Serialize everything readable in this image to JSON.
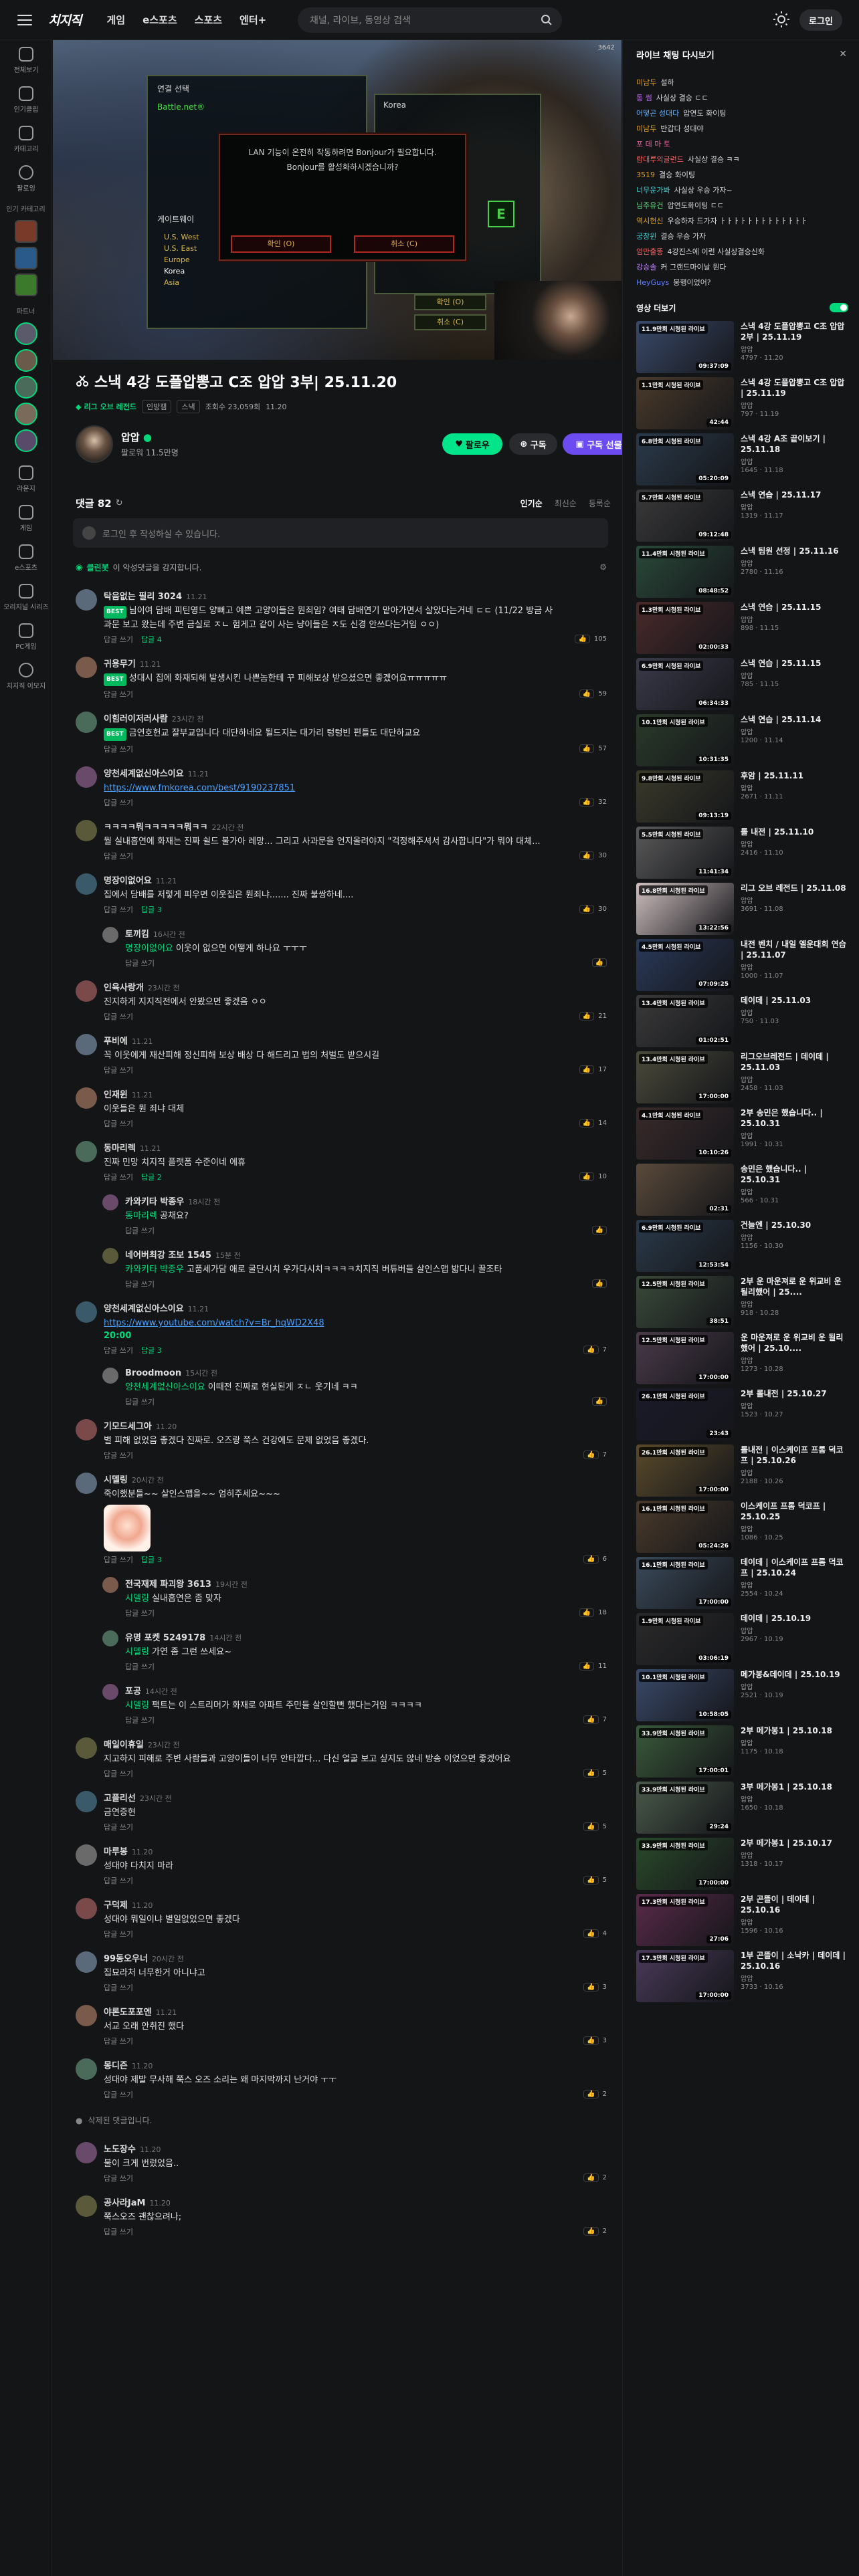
{
  "header": {
    "logo": "치지직",
    "nav": [
      "게임",
      "e스포츠",
      "스포츠",
      "엔터+"
    ],
    "search_placeholder": "채널, 라이브, 동영상 검색",
    "login": "로그인"
  },
  "sidebar": {
    "items": [
      "전체보기",
      "인기클립",
      "카테고리",
      "팔로잉"
    ],
    "section_recommend": "인기 카테고리",
    "section_partner": "파트너",
    "items2": [
      "라운지",
      "게임",
      "e스포츠",
      "오리지널 시리즈",
      "PC게임",
      "치지직 이모지"
    ]
  },
  "player": {
    "panel_title": "연결 선택",
    "panel_mode": "Battle.net®",
    "panel_region": "게이트웨이",
    "regions": [
      "U.S. West",
      "U.S. East",
      "Europe",
      "Korea",
      "Asia"
    ],
    "right_title": "Korea",
    "dialog_text_1": "LAN 기능이 온전히 작동하려면 Bonjour가 필요합니다.",
    "dialog_text_2": "Bonjour를 활성화하시겠습니까?",
    "dialog_ok": "확인 (O)",
    "dialog_cancel": "취소 (C)",
    "btn_ok": "확인 (O)",
    "btn_cancel": "취소 (C)",
    "e_key": "E",
    "fps": "3642"
  },
  "video": {
    "title": "스낵 4강 도플압뽕고 C조 압압 3부|  25.11.20",
    "category": "리그 오브 레전드",
    "tags": [
      "인방잼",
      "스낵"
    ],
    "views": "조회수 23,059회",
    "date": "11.20"
  },
  "channel": {
    "name": "압압",
    "followers": "팔로워 11.5만명",
    "follow": "팔로우",
    "subscribe": "구독",
    "gift": "구독 선물"
  },
  "comments": {
    "count": "댓글 82",
    "sort": [
      "인기순",
      "최신순",
      "등록순"
    ],
    "input_placeholder": "로그인 후 작성하실 수 있습니다.",
    "clean_label": "클린봇",
    "clean_text": "이 악성댓글을 감지합니다.",
    "reply_label": "답글 쓰기",
    "list": [
      {
        "name": "탁음없는 필리 3024",
        "time": "11.21",
        "best": true,
        "text": "님이여 담배 피틴영드 양뻐고 예쁜 고양이들은 뭔죄임? 여태 담배연기 맡아가면서 살았다는거네 ㄷㄷ (11/22 방금 사과문 보고 왔는데 주변 금실로 ㅈㄴ 험게고 같이 사는 냥이들은 ㅈ도 신경 안쓰다는거임 ㅇㅇ)",
        "replies": "답글 4",
        "likes": "105",
        "reply": false
      },
      {
        "name": "귀용무기",
        "time": "11.21",
        "best": true,
        "text": "성대시 집에 화재되해 발생시킨 나쁜놈한테 꾸 피해보상 받으셨으면 좋겠어요ㅠㅠㅠㅠㅠ",
        "replies": "",
        "likes": "59",
        "reply": false
      },
      {
        "name": "이힘러이저러사람",
        "time": "23시간 전",
        "best": true,
        "text": "금연호헌교 잘부교입니다 대단하네요 될드지는 대가리 텅텅빈 편들도 대단하교요",
        "replies": "",
        "likes": "57",
        "reply": false
      },
      {
        "name": "양천세계없신아스이요",
        "time": "11.21",
        "best": false,
        "link": "https://www.fmkorea.com/best/9190237851",
        "text": "",
        "replies": "",
        "likes": "32",
        "reply": false
      },
      {
        "name": "ㅋㅋㅋㅋ뭐ㅋㅋㅋㅋㅋ뭐ㅋㅋ",
        "time": "22시간 전",
        "best": false,
        "text": "뭘 실내흡연에 화재는 진짜 쉴드 불가아 레망... 그리고 사과문을 언지올려야지 \"걱정해주셔서 감사합니다\"가 뭐야 대체...",
        "replies": "",
        "likes": "30",
        "reply": false
      },
      {
        "name": "명장이없어요",
        "time": "11.21",
        "best": false,
        "text": "집에서 담배를 저렇게 피우면 이웃집은 뭔죄냐....... 진짜 불쌍하네....",
        "replies": "답글 3",
        "likes": "30",
        "reply": false
      },
      {
        "name": "토끼킴",
        "time": "16시간 전",
        "best": false,
        "mention": "명장이없어요",
        "text": "이웃이 없으면 어떻게 하나요 ㅜㅜㅜ",
        "replies": "",
        "likes": "",
        "reply": true
      },
      {
        "name": "인육사랑개",
        "time": "23시간 전",
        "best": false,
        "text": "진지하게 지지직전에서 안봤으면 좋겠음 ㅇㅇ",
        "replies": "",
        "likes": "21",
        "reply": false
      },
      {
        "name": "푸비에",
        "time": "11.21",
        "best": false,
        "text": "꼭 이웃에게 재산피해 정신피해 보상 배상 다 해드리고 법의 처벌도 받으시길",
        "replies": "",
        "likes": "17",
        "reply": false
      },
      {
        "name": "인재윈",
        "time": "11.21",
        "best": false,
        "text": "이웃들은 뭔 죄냐 대체",
        "replies": "",
        "likes": "14",
        "reply": false
      },
      {
        "name": "동마리렉",
        "time": "11.21",
        "best": false,
        "text": "진짜 민망 치지직 플랫폼 수준이네 에휴",
        "replies": "답글 2",
        "likes": "10",
        "reply": false
      },
      {
        "name": "카와키타 박종우",
        "time": "18시간 전",
        "best": false,
        "mention": "동마리렉",
        "text": "공채요?",
        "replies": "",
        "likes": "",
        "reply": true
      },
      {
        "name": "네어버최강 조보 1545",
        "time": "15분 전",
        "best": false,
        "mention": "카와키타 박종우",
        "text": "고품세가담 애로 굴단시치 우가다시치ㅋㅋㅋㅋ치지직 버튜버들 살인스맵 밟다니 꿀조타",
        "replies": "",
        "likes": "",
        "reply": true
      },
      {
        "name": "양천세계없신아스이요",
        "time": "11.21",
        "best": false,
        "link": "https://www.youtube.com/watch?v=Br_hqWD2X48",
        "timestamp": "20:00",
        "text": "",
        "replies": "답글 3",
        "likes": "7",
        "reply": false
      },
      {
        "name": "Broodmoon",
        "time": "15시간 전",
        "best": false,
        "mention": "양천세계없신아스이요",
        "text": "이때전 진짜로 현실된게 ㅈㄴ 웃기네 ㅋㅋ",
        "replies": "",
        "likes": "",
        "reply": true
      },
      {
        "name": "기모드세그아",
        "time": "11.20",
        "best": false,
        "text": "별 피해 없었음 좋겠다 진짜로. 오즈랑 쭉스 건강에도 문제 없었음 좋겠다.",
        "replies": "",
        "likes": "7",
        "reply": false
      },
      {
        "name": "시델링",
        "time": "20시간 전",
        "best": false,
        "text": "죽이했분들~~ 살인스맵을~~ 엄히주세요~~~",
        "emoji": true,
        "replies": "답글 3",
        "likes": "6",
        "reply": false
      },
      {
        "name": "전국재제 파괴왕 3613",
        "time": "19시간 전",
        "best": false,
        "mention": "시델링",
        "text": "실내흡연은 좀 맞자",
        "replies": "",
        "likes": "18",
        "reply": true
      },
      {
        "name": "유명 포켓 5249178",
        "time": "14시간 전",
        "best": false,
        "mention": "시델링",
        "text": "가연 좀 그런 쓰세요~",
        "replies": "",
        "likes": "11",
        "reply": true
      },
      {
        "name": "포공",
        "time": "14시간 전",
        "best": false,
        "mention": "시델링",
        "text": "팩트는 이 스트리머가 화재로 아파트 주민들 살인할뻔 했다는거임 ㅋㅋㅋㅋ",
        "replies": "",
        "likes": "7",
        "reply": true
      },
      {
        "name": "매일이휴일",
        "time": "23시간 전",
        "best": false,
        "text": "지고하지 피해로 주변 사람들과 고양이들이 너무 안타깝다... 다신 얼굴 보고 싶지도 않네 방송 이었으면 좋겠어요",
        "replies": "",
        "likes": "5",
        "reply": false
      },
      {
        "name": "고플리선",
        "time": "23시간 전",
        "best": false,
        "text": "금연증현",
        "replies": "",
        "likes": "5",
        "reply": false
      },
      {
        "name": "마루봉",
        "time": "11.20",
        "best": false,
        "text": "성대야 다치지 마라",
        "replies": "",
        "likes": "5",
        "reply": false
      },
      {
        "name": "구덕제",
        "time": "11.20",
        "best": false,
        "text": "성대야 뭐일이냐 별일없었으면 좋겠다",
        "replies": "",
        "likes": "4",
        "reply": false
      },
      {
        "name": "99동오우너",
        "time": "20시간 전",
        "best": false,
        "text": "집묘라처 너무한거 아니냐고",
        "replies": "",
        "likes": "3",
        "reply": false
      },
      {
        "name": "야론도포포엔",
        "time": "11.21",
        "best": false,
        "text": "서교 오래 안취진 했다",
        "replies": "",
        "likes": "3",
        "reply": false
      },
      {
        "name": "몽디즌",
        "time": "11.20",
        "best": false,
        "text": "성대야 제발 무사해 쭉스 오즈 소리는 왜 마지막까지 난거야 ㅜㅜ",
        "replies": "",
        "likes": "2",
        "reply": false
      }
    ],
    "deleted": "삭제된 댓글입니다.",
    "list_b": [
      {
        "name": "노도장수",
        "time": "11.20",
        "text": "불이 크게 번렀었음..",
        "likes": "2"
      },
      {
        "name": "공사라JaM",
        "time": "11.20",
        "text": "쭉스오즈 괜찮으려나;",
        "likes": "2"
      }
    ]
  },
  "chat": {
    "title": "라이브 채팅 다시보기",
    "messages": [
      {
        "n": "미남두",
        "m": "설하",
        "c": "#e0a020"
      },
      {
        "n": "통 썸",
        "m": "사실상 결승 ㄷㄷ",
        "c": "#c060f0"
      },
      {
        "n": "어떻곤 성대다",
        "m": "압연도 화이팅",
        "c": "#60b0ff"
      },
      {
        "n": "미남두",
        "m": "반갑다 성대야",
        "c": "#e0a020"
      },
      {
        "n": "포 데 마 토",
        "m": "",
        "c": "#f060a0"
      },
      {
        "n": "람대루의글런드",
        "m": "사실상 결승 ㅋㅋ",
        "c": "#ff6060"
      },
      {
        "n": "3519",
        "m": "결승 화이팅",
        "c": "#e0a020"
      },
      {
        "n": "너무운가봐",
        "m": "사실상 우승 가자~",
        "c": "#40d0d0"
      },
      {
        "n": "님주유건",
        "m": "압연도화이팅 ㄷㄷ",
        "c": "#60e080"
      },
      {
        "n": "역시헌신",
        "m": "우승하자 드가자 ㅏㅏㅏㅏㅏㅏㅏㅏㅏㅏㅏㅏㅏ",
        "c": "#e0a020"
      },
      {
        "n": "궁창윈",
        "m": "결승 우승 가자",
        "c": "#40d0d0"
      },
      {
        "n": "엄만출똥",
        "m": "4강진스에 이런 사실상결승신화",
        "c": "#f06060"
      },
      {
        "n": "강승솔",
        "m": "커 그랜드마이날 뭔다",
        "c": "#c080ff"
      },
      {
        "n": "HeyGuys",
        "m": "뭉행이었어?",
        "c": "#6080ff"
      }
    ],
    "video_list_title": "영상 더보기"
  },
  "videos": [
    {
      "badge": "11.9만회 시청된 라이브",
      "dur": "09:37:09",
      "title": "스낵 4강 도플압뽕고 C조 압압 2부 | 25.11.19",
      "ch": "압압",
      "stat": "4797 · 11.20",
      "c": "#3a4a6a"
    },
    {
      "badge": "1.1만회 시청된 라이브",
      "dur": "42:44",
      "title": "스낵 4강 도플압뽕고 C조 압압 | 25.11.19",
      "ch": "압압",
      "stat": "797 · 11.19",
      "c": "#4a3a2a"
    },
    {
      "badge": "6.8만회 시청된 라이브",
      "dur": "05:20:09",
      "title": "스낵 4강 A조 끝이보기 | 25.11.18",
      "ch": "압압",
      "stat": "1645 · 11.18",
      "c": "#2a3a4a"
    },
    {
      "badge": "5.7만회 시청된 라이브",
      "dur": "09:12:48",
      "title": "스낵 연습 | 25.11.17",
      "ch": "압압",
      "stat": "1319 · 11.17",
      "c": "#3a3a3a"
    },
    {
      "badge": "11.4만회 시청된 라이브",
      "dur": "08:48:52",
      "title": "스낵 팀원 선정 | 25.11.16",
      "ch": "압압",
      "stat": "2780 · 11.16",
      "c": "#2a4a3a"
    },
    {
      "badge": "1.3만회 시청된 라이브",
      "dur": "02:00:33",
      "title": "스낵 연습 | 25.11.15",
      "ch": "압압",
      "stat": "898 · 11.15",
      "c": "#4a2a2a"
    },
    {
      "badge": "6.9만회 시청된 라이브",
      "dur": "06:34:33",
      "title": "스낵 연습 | 25.11.15",
      "ch": "압압",
      "stat": "785 · 11.15",
      "c": "#3a3a4a"
    },
    {
      "badge": "10.1만회 시청된 라이브",
      "dur": "10:31:35",
      "title": "스낵 연습 | 25.11.14",
      "ch": "압압",
      "stat": "1200 · 11.14",
      "c": "#2a3a2a"
    },
    {
      "badge": "9.8만회 시청된 라이브",
      "dur": "09:13:19",
      "title": "후암 | 25.11.11",
      "ch": "압압",
      "stat": "2671 · 11.11",
      "c": "#3a3a2a"
    },
    {
      "badge": "5.5만회 시청된 라이브",
      "dur": "11:41:34",
      "title": "롤 내전 | 25.11.10",
      "ch": "압압",
      "stat": "2416 · 11.10",
      "c": "#5a5a5a"
    },
    {
      "badge": "16.8만회 시청된 라이브",
      "dur": "13:22:56",
      "title": "리그 오브 레전드 | 25.11.08",
      "ch": "압압",
      "stat": "3691 · 11.08",
      "c": "#d0c0c0"
    },
    {
      "badge": "4.5만회 시청된 라이브",
      "dur": "07:09:25",
      "title": "내전 벤치 / 내일 엘운대회 연습 | 25.11.07",
      "ch": "압압",
      "stat": "1000 · 11.07",
      "c": "#2a3a5a"
    },
    {
      "badge": "13.4만회 시청된 라이브",
      "dur": "01:02:51",
      "title": "데이데 | 25.11.03",
      "ch": "압압",
      "stat": "750 · 11.03",
      "c": "#3a3a3a"
    },
    {
      "badge": "13.4만회 시청된 라이브",
      "dur": "17:00:00",
      "title": "리그오브레전드 | 데이데 | 25.11.03",
      "ch": "압압",
      "stat": "2458 · 11.03",
      "c": "#4a4a3a"
    },
    {
      "badge": "4.1만회 시청된 라이브",
      "dur": "10:10:26",
      "title": "2부 송민은 했습니다.. | 25.10.31",
      "ch": "압압",
      "stat": "1991 · 10.31",
      "c": "#3a2a2a"
    },
    {
      "badge": "",
      "dur": "02:31",
      "title": "송민은 했습니다.. | 25.10.31",
      "ch": "압압",
      "stat": "566 · 10.31",
      "c": "#5a4a3a"
    },
    {
      "badge": "6.9만회 시청된 라이브",
      "dur": "12:53:54",
      "title": "건늘엔 | 25.10.30",
      "ch": "압압",
      "stat": "1156 · 10.30",
      "c": "#2a3a4a"
    },
    {
      "badge": "12.5만회 시청된 라이브",
      "dur": "38:51",
      "title": "2부 운 마운져로 운 위교비 운 될리했어 | 25....",
      "ch": "압압",
      "stat": "918 · 10.28",
      "c": "#3a4a3a"
    },
    {
      "badge": "12.5만회 시청된 라이브",
      "dur": "17:00:00",
      "title": "운 마운져로 운 위교비 운 될리했어 | 25.10....",
      "ch": "압압",
      "stat": "1273 · 10.28",
      "c": "#4a3a4a"
    },
    {
      "badge": "26.1만회 시청된 라이브",
      "dur": "23:43",
      "title": "2부 롤내전 | 25.10.27",
      "ch": "압압",
      "stat": "1523 · 10.27",
      "c": "#1a1a2a"
    },
    {
      "badge": "26.1만회 시청된 라이브",
      "dur": "17:00:00",
      "title": "롤내전 | 이스케이프 프롬 덕코프 | 25.10.26",
      "ch": "압압",
      "stat": "2188 · 10.26",
      "c": "#5a4a2a"
    },
    {
      "badge": "16.1만회 시청된 라이브",
      "dur": "05:24:26",
      "title": "이스케이프 프롬 덕코프 | 25.10.25",
      "ch": "압압",
      "stat": "1086 · 10.25",
      "c": "#4a3a2a"
    },
    {
      "badge": "16.1만회 시청된 라이브",
      "dur": "17:00:00",
      "title": "데이데 | 이스케이프 프롬 덕코프 | 25.10.24",
      "ch": "압압",
      "stat": "2554 · 10.24",
      "c": "#3a4a5a"
    },
    {
      "badge": "1.9만회 시청된 라이브",
      "dur": "03:06:19",
      "title": "데이데 | 25.10.19",
      "ch": "압압",
      "stat": "2967 · 10.19",
      "c": "#2a2a2a"
    },
    {
      "badge": "10.1만회 시청된 라이브",
      "dur": "10:58:05",
      "title": "메가봉&데이데 | 25.10.19",
      "ch": "압압",
      "stat": "2521 · 10.19",
      "c": "#3a4a6a"
    },
    {
      "badge": "33.9만회 시청된 라이브",
      "dur": "17:00:01",
      "title": "2부 메가봉1 | 25.10.18",
      "ch": "압압",
      "stat": "1175 · 10.18",
      "c": "#3a5a3a"
    },
    {
      "badge": "33.9만회 시청된 라이브",
      "dur": "29:24",
      "title": "3부 메가봉1 | 25.10.18",
      "ch": "압압",
      "stat": "1650 · 10.18",
      "c": "#4a5a4a"
    },
    {
      "badge": "33.9만회 시청된 라이브",
      "dur": "17:00:00",
      "title": "2부 메가봉1 | 25.10.17",
      "ch": "압압",
      "stat": "1318 · 10.17",
      "c": "#2a4a2a"
    },
    {
      "badge": "17.3만회 시청된 라이브",
      "dur": "27:06",
      "title": "2부 곤뜰이 | 데이데 | 25.10.16",
      "ch": "압압",
      "stat": "1596 · 10.16",
      "c": "#5a2a4a"
    },
    {
      "badge": "17.3만회 시청된 라이브",
      "dur": "17:00:00",
      "title": "1부 곤뜰이 | 소낙카 | 데이데 | 25.10.16",
      "ch": "압압",
      "stat": "3733 · 10.16",
      "c": "#4a3a5a"
    }
  ]
}
